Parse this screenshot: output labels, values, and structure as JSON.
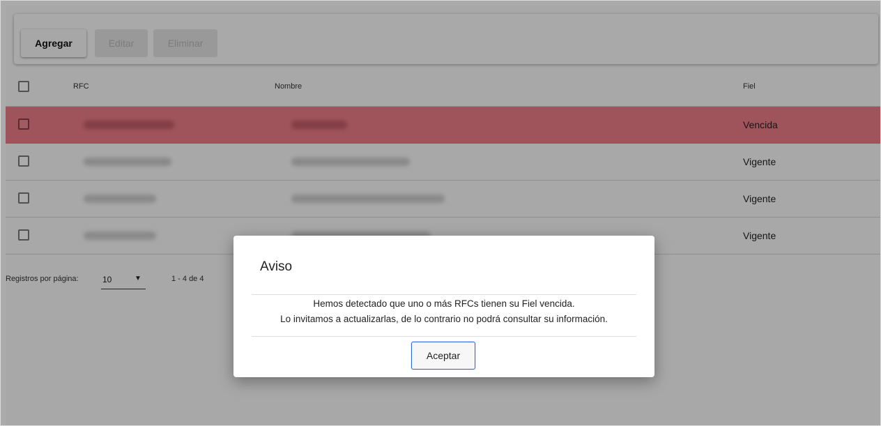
{
  "toolbar": {
    "add_label": "Agregar",
    "edit_label": "Editar",
    "delete_label": "Eliminar"
  },
  "table": {
    "columns": [
      "RFC",
      "Nombre",
      "Fiel"
    ],
    "rows": [
      {
        "fiel": "Vencida",
        "status": "expired"
      },
      {
        "fiel": "Vigente",
        "status": "valid"
      },
      {
        "fiel": "Vigente",
        "status": "valid"
      },
      {
        "fiel": "Vigente",
        "status": "valid"
      }
    ]
  },
  "pagination": {
    "label": "Registros por página:",
    "per_page": "10",
    "range": "1 - 4 de 4"
  },
  "dialog": {
    "title": "Aviso",
    "message_line1": "Hemos detectado que uno o más RFCs tienen su Fiel vencida.",
    "message_line2": "Lo invitamos a actualizarlas, de lo contrario no podrá consultar su información.",
    "accept_label": "Aceptar"
  },
  "colors": {
    "expired_row": "#ed7e88",
    "dialog_button_border": "#2f6bd9"
  }
}
